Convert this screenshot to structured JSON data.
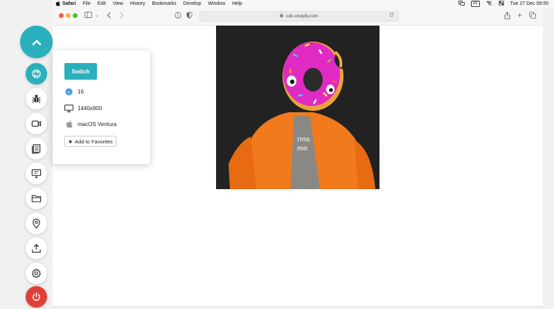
{
  "menubar": {
    "apple": "",
    "items": [
      "Safari",
      "File",
      "Edit",
      "View",
      "History",
      "Bookmarks",
      "Develop",
      "Window",
      "Help"
    ],
    "keyboard": "US",
    "datetime": "Tue 27 Dec  09:55"
  },
  "browser": {
    "url": "cdn.shopify.com"
  },
  "panel": {
    "switch_label": "Switch",
    "browser_version": "16",
    "resolution": "1440x900",
    "os": "macOS Ventura",
    "favorites_label": "Add to Favorites"
  },
  "colors": {
    "accent": "#2ab0bd",
    "power": "#e0403a"
  }
}
